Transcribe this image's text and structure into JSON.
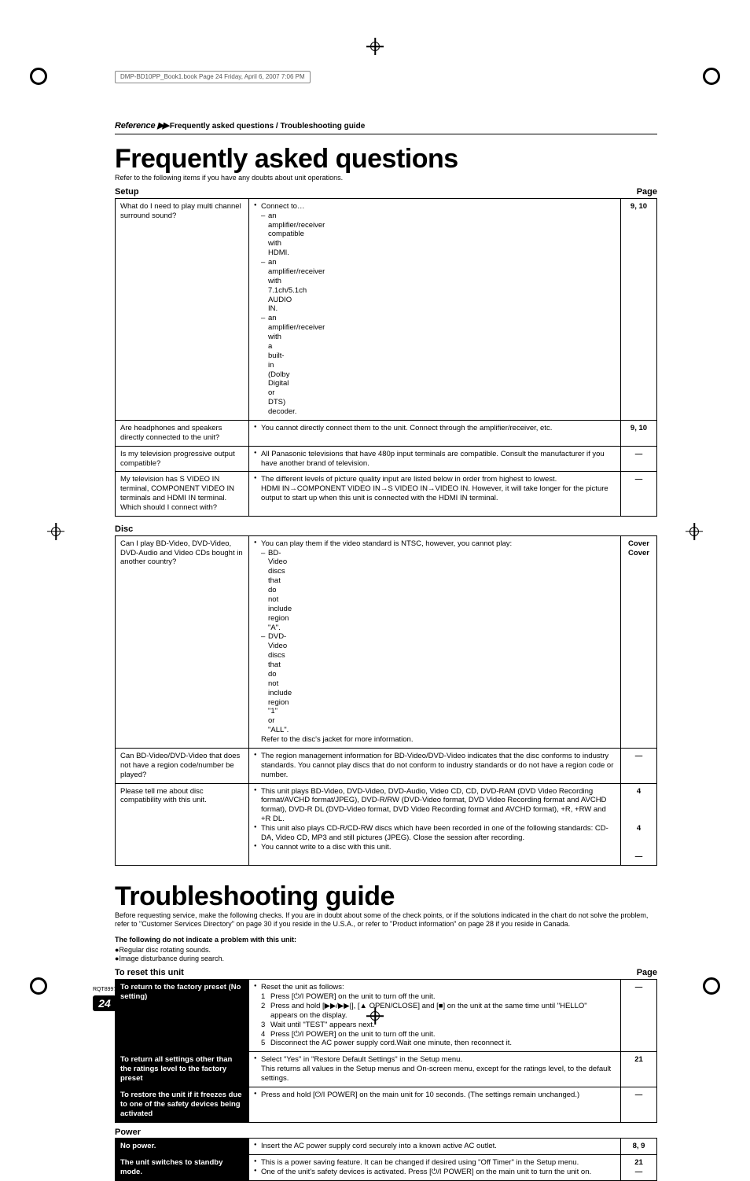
{
  "meta": {
    "book_header": "DMP-BD10PP_Book1.book  Page 24  Friday, April 6, 2007  7:06 PM",
    "rqt": "RQT8997",
    "page_number": "24",
    "reference_label": "Reference",
    "reference_arrows": "▶▶",
    "reference_sub": "Frequently asked questions / Troubleshooting guide"
  },
  "faq": {
    "title": "Frequently asked questions",
    "intro": "Refer to the following items if you have any doubts about unit operations.",
    "page_header": "Page",
    "sections": [
      {
        "name": "Setup",
        "rows": [
          {
            "q": "What do I need to play multi channel surround sound?",
            "a_lead": "Connect to…",
            "a_sub": [
              "an amplifier/receiver compatible with HDMI.",
              "an amplifier/receiver with 7.1ch/5.1ch AUDIO IN.",
              "an amplifier/receiver with a built-in (Dolby Digital or DTS) decoder."
            ],
            "page": "9, 10"
          },
          {
            "q": "Are headphones and speakers directly connected to the unit?",
            "a": "You cannot directly connect them to the unit. Connect through the amplifier/receiver, etc.",
            "page": "9, 10"
          },
          {
            "q": "Is my television progressive output compatible?",
            "a": "All Panasonic televisions that have 480p input terminals are compatible. Consult the manufacturer if you have another brand of television.",
            "page": "—"
          },
          {
            "q": "My television has S VIDEO IN terminal, COMPONENT VIDEO IN terminals and HDMI IN terminal. Which should I connect with?",
            "a_multi": [
              "The different levels of picture quality input are listed below in order from highest to lowest.",
              "HDMI IN→COMPONENT VIDEO IN→S VIDEO IN→VIDEO IN. However, it will take longer for the picture output to start up when this unit is connected with the HDMI IN terminal."
            ],
            "page": "—"
          }
        ]
      },
      {
        "name": "Disc",
        "rows": [
          {
            "q": "Can I play BD-Video, DVD-Video, DVD-Audio and Video CDs bought in another country?",
            "a_lead": "You can play them if the video standard is NTSC, however, you cannot play:",
            "a_sub": [
              "BD-Video discs that do not include region \"A\".",
              "DVD-Video discs that do not include region \"1\" or \"ALL\"."
            ],
            "a_tail": "Refer to the disc's jacket for more information.",
            "page": "Cover\nCover"
          },
          {
            "q": "Can BD-Video/DVD-Video that does not have a region code/number be played?",
            "a": "The region management information for BD-Video/DVD-Video indicates that the disc conforms to industry standards. You cannot play discs that do not conform to industry standards or do not have a region code or number.",
            "page": "—"
          },
          {
            "q": "Please tell me about disc compatibility with this unit.",
            "a_items": [
              "This unit plays BD-Video, DVD-Video, DVD-Audio, Video CD, CD, DVD-RAM (DVD Video Recording format/AVCHD format/JPEG), DVD-R/RW (DVD-Video format, DVD Video Recording format and AVCHD format), DVD-R DL (DVD-Video format, DVD Video Recording format and AVCHD format), +R, +RW and +R DL.",
              "This unit also plays CD-R/CD-RW discs which have been recorded in one of the following standards: CD-DA, Video CD, MP3 and still pictures (JPEG). Close the session after recording.",
              "You cannot write to a disc with this unit."
            ],
            "pages": [
              "4",
              "4",
              "—"
            ]
          }
        ]
      }
    ]
  },
  "trouble": {
    "title": "Troubleshooting guide",
    "intro": "Before requesting service, make the following checks. If you are in doubt about some of the check points, or if the solutions indicated in the chart do not solve the problem, refer to \"Customer Services Directory\" on page 30 if you reside in the U.S.A., or refer to \"Product information\" on page 28 if you reside in Canada.",
    "warn_head": "The following do not indicate a problem with this unit:",
    "warn_items": [
      "Regular disc rotating sounds.",
      "Image disturbance during search."
    ],
    "page_header": "Page",
    "sections": [
      {
        "name": "To reset this unit",
        "rows": [
          {
            "q": "To return to the factory preset (No setting)",
            "a_lead": "Reset the unit as follows:",
            "a_steps": [
              "Press [⏻/I POWER] on the unit to turn off the unit.",
              "Press and hold [▶▶/▶▶|], [▲ OPEN/CLOSE] and [■] on the unit at the same time until \"HELLO\" appears on the display.",
              "Wait until \"TEST\" appears next.",
              "Press [⏻/I POWER] on the unit to turn off the unit.",
              "Disconnect the AC power supply cord.Wait one minute, then reconnect it."
            ],
            "page": "—"
          },
          {
            "q": "To return all settings other than the ratings level to the factory preset",
            "a_multi": [
              "Select \"Yes\" in \"Restore Default Settings\" in the Setup menu.",
              "This returns all values in the Setup menus and On-screen menu, except for the ratings level, to the default settings."
            ],
            "page": "21"
          },
          {
            "q": "To restore the unit if it freezes due to one of the safety devices being activated",
            "a": "Press and hold [⏻/I POWER] on the main unit for 10 seconds. (The settings remain unchanged.)",
            "page": "—"
          }
        ]
      },
      {
        "name": "Power",
        "rows": [
          {
            "q": "No power.",
            "a": "Insert the AC power supply cord securely into a known active AC outlet.",
            "page": "8, 9"
          },
          {
            "q": "The unit switches to standby mode.",
            "a_items": [
              "This is a power saving feature. It can be changed if desired using \"Off Timer\" in the Setup menu.",
              "One of the unit's safety devices is activated. Press [⏻/I POWER] on the main unit to turn the unit on."
            ],
            "pages": [
              "21",
              "—"
            ]
          }
        ]
      }
    ]
  }
}
